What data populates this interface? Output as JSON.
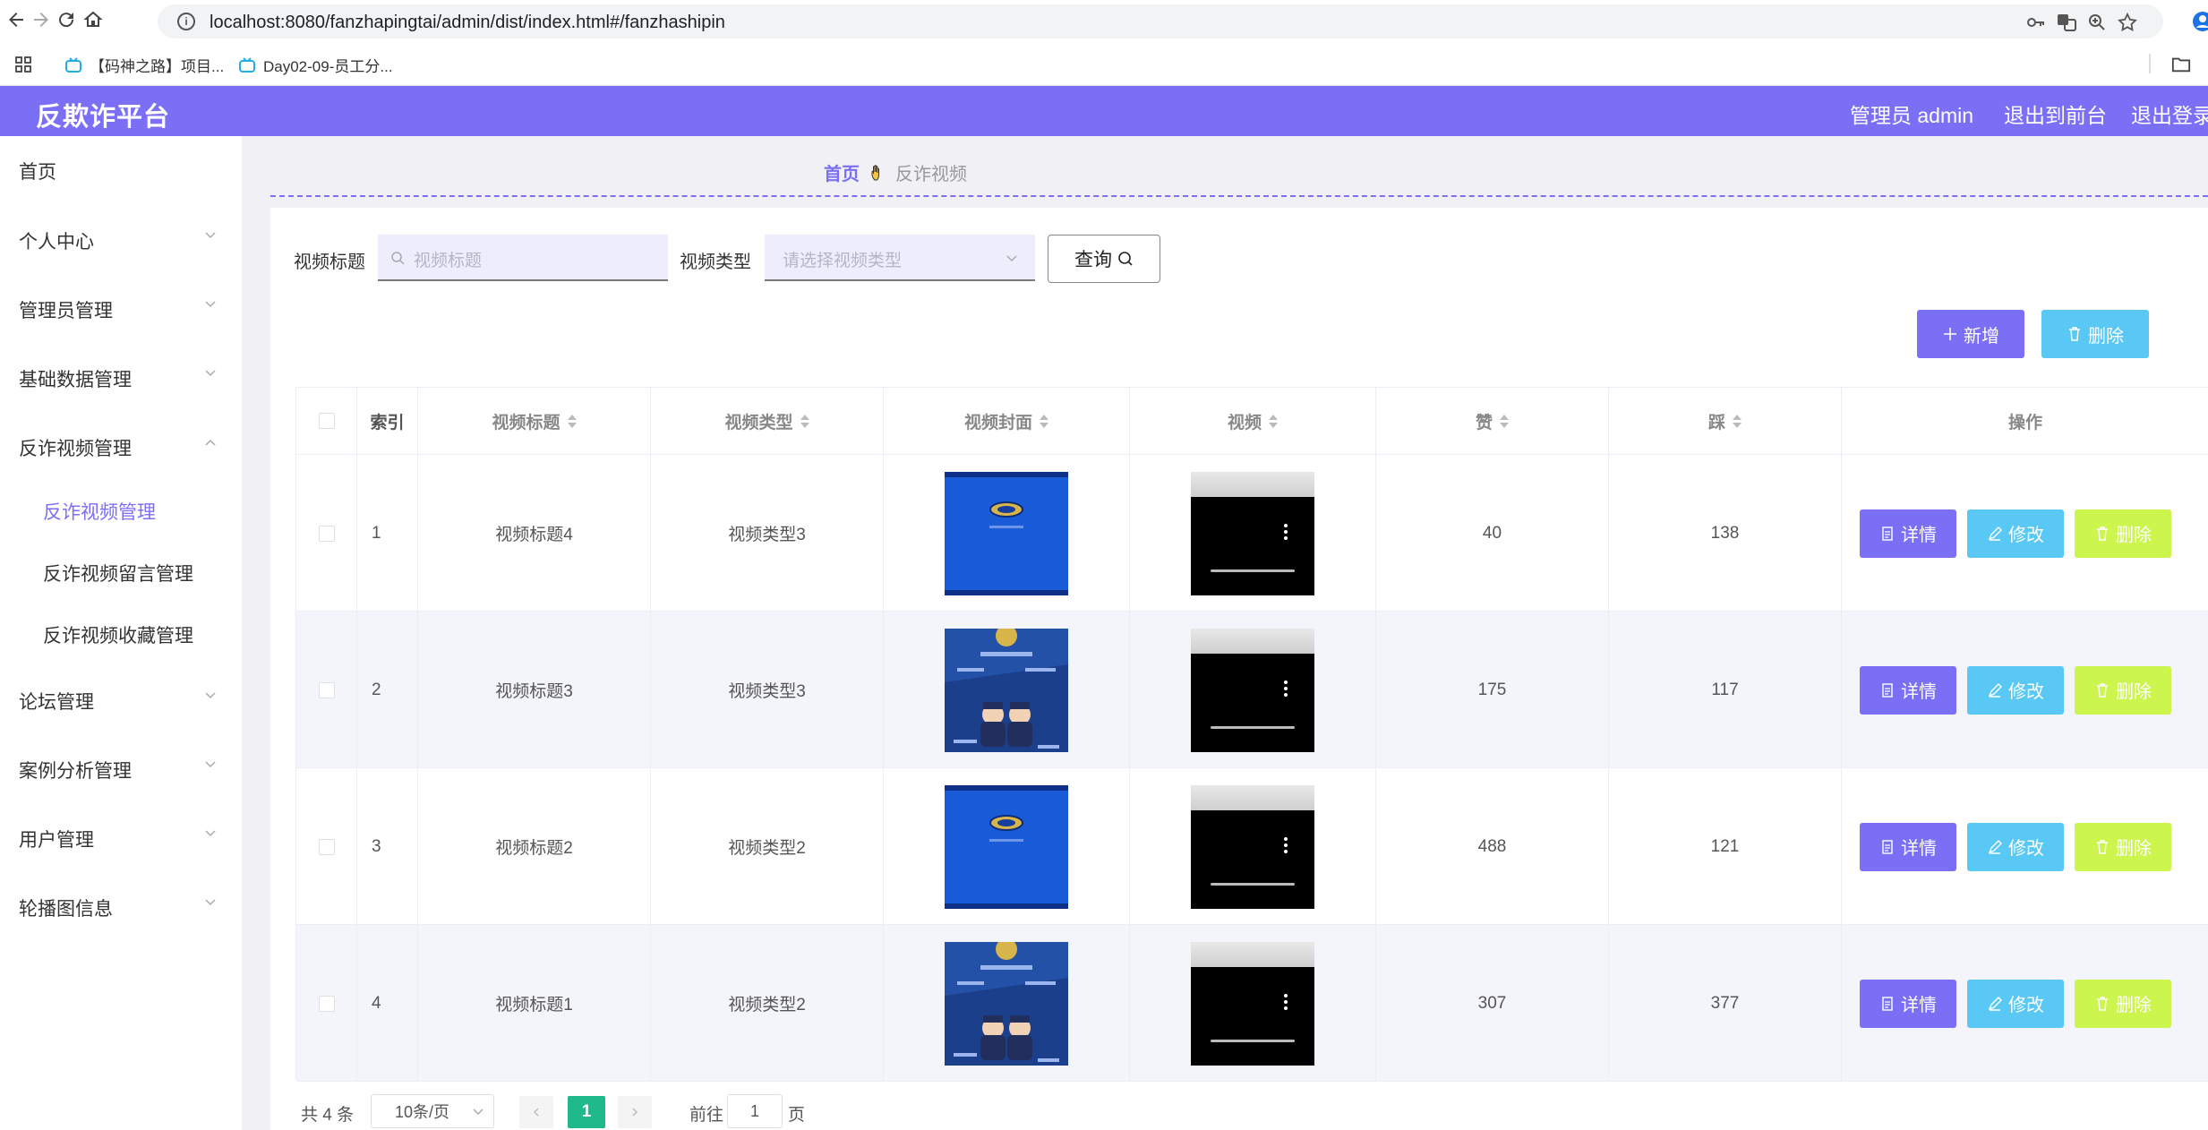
{
  "browser": {
    "url": "localhost:8080/fanzhapingtai/admin/dist/index.html#/fanzhashipin",
    "bookmarks": [
      "【码神之路】项目...",
      "Day02-09-员工分..."
    ]
  },
  "header": {
    "title": "反欺诈平台",
    "user": "管理员 admin",
    "to_front": "退出到前台",
    "logout": "退出登录"
  },
  "sidebar": {
    "items": [
      {
        "label": "首页"
      },
      {
        "label": "个人中心"
      },
      {
        "label": "管理员管理"
      },
      {
        "label": "基础数据管理"
      },
      {
        "label": "反诈视频管理"
      },
      {
        "label": "论坛管理"
      },
      {
        "label": "案例分析管理"
      },
      {
        "label": "用户管理"
      },
      {
        "label": "轮播图信息"
      }
    ],
    "sub_items": [
      {
        "label": "反诈视频管理",
        "active": true
      },
      {
        "label": "反诈视频留言管理"
      },
      {
        "label": "反诈视频收藏管理"
      }
    ]
  },
  "breadcrumb": {
    "home": "首页",
    "current": "反诈视频"
  },
  "search": {
    "title_label": "视频标题",
    "title_placeholder": "视频标题",
    "type_label": "视频类型",
    "type_placeholder": "请选择视频类型",
    "query_label": "查询"
  },
  "actions": {
    "add_label": "新增",
    "delete_label": "删除"
  },
  "table": {
    "columns": [
      "索引",
      "视频标题",
      "视频类型",
      "视频封面",
      "视频",
      "赞",
      "踩",
      "操作"
    ],
    "rows": [
      {
        "index": "1",
        "title": "视频标题4",
        "type": "视频类型3",
        "likes": "40",
        "dislikes": "138"
      },
      {
        "index": "2",
        "title": "视频标题3",
        "type": "视频类型3",
        "likes": "175",
        "dislikes": "117"
      },
      {
        "index": "3",
        "title": "视频标题2",
        "type": "视频类型2",
        "likes": "488",
        "dislikes": "121"
      },
      {
        "index": "4",
        "title": "视频标题1",
        "type": "视频类型2",
        "likes": "307",
        "dislikes": "377"
      }
    ],
    "row_actions": {
      "detail": "详情",
      "edit": "修改",
      "delete": "删除"
    }
  },
  "pagination": {
    "total": "共 4 条",
    "page_size": "10条/页",
    "current_page": "1",
    "goto_label": "前往",
    "goto_value": "1",
    "page_suffix": "页"
  },
  "colors": {
    "accent": "#7b6ff6",
    "info": "#5ac8f5",
    "warn": "#ccf54d",
    "pager_active": "#1fb98c"
  }
}
